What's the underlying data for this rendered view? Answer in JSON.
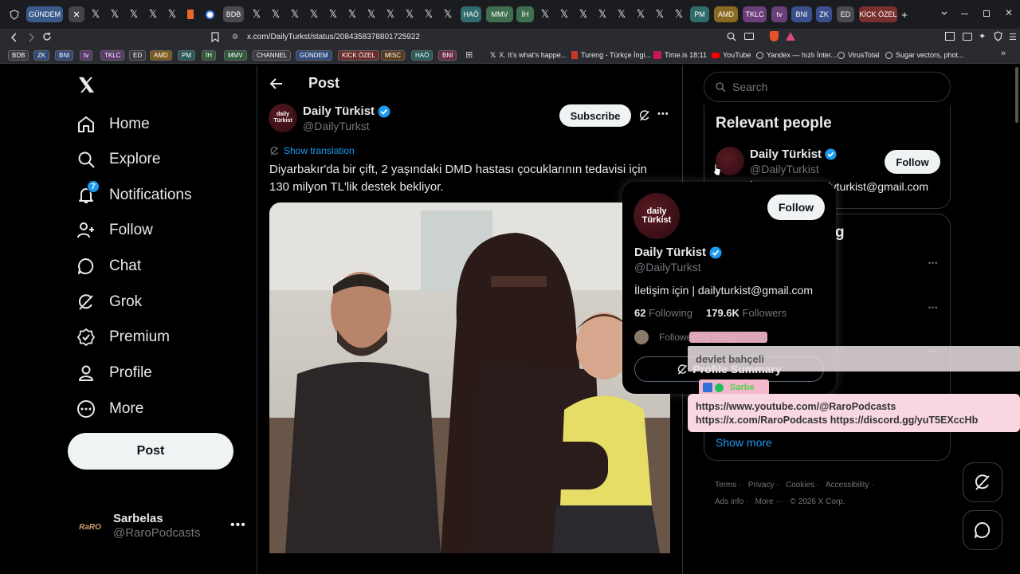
{
  "browser": {
    "tabs": [
      {
        "label": "GÜNDEM",
        "color": "#3a5a8c"
      },
      {
        "label": "BDB",
        "color": "#4a4a52"
      },
      {
        "label": "HAÖ",
        "color": "#2f6c6c"
      },
      {
        "label": "MMV",
        "color": "#3f6f4f"
      },
      {
        "label": "İH",
        "color": "#3f6f4f"
      },
      {
        "label": "PM",
        "color": "#2f6c6c"
      },
      {
        "label": "AMD",
        "color": "#8a6a20"
      },
      {
        "label": "TKLC",
        "color": "#6a3f7a"
      },
      {
        "label": "tv",
        "color": "#6a3f7a"
      },
      {
        "label": "BNI",
        "color": "#3a4f8c"
      },
      {
        "label": "ZK",
        "color": "#3a4f8c"
      },
      {
        "label": "ED",
        "color": "#4a4a52"
      },
      {
        "label": "KİCK ÖZEL",
        "color": "#7a2f2f"
      }
    ],
    "x_tab_glyph": "𝕏",
    "new_tab": "+",
    "url": "x.com/DailyTurkst/status/2084358378801725922",
    "bookmarks_tags": [
      "BDB",
      "ZK",
      "BNI",
      "tv",
      "TKLC",
      "ED",
      "AMD",
      "PM",
      "İH",
      "MMV",
      "CHANNEL",
      "GÜNDEM",
      "KİCK ÖZEL",
      "MISC",
      "HAÖ",
      "BNİ"
    ],
    "bookmark_links": [
      "X. It's what's happe...",
      "Tureng - Türkçe İngi...",
      "Time.is 18:11",
      "YouTube",
      "Yandex — hızlı İnter...",
      "VirusTotal",
      "Sugar vectors, phot..."
    ]
  },
  "sidebar": {
    "items": [
      {
        "label": "Home",
        "icon": "home-icon"
      },
      {
        "label": "Explore",
        "icon": "search-icon"
      },
      {
        "label": "Notifications",
        "icon": "bell-icon",
        "badge": "7"
      },
      {
        "label": "Follow",
        "icon": "add-user-icon"
      },
      {
        "label": "Chat",
        "icon": "chat-icon"
      },
      {
        "label": "Grok",
        "icon": "grok-icon"
      },
      {
        "label": "Premium",
        "icon": "premium-icon"
      },
      {
        "label": "Profile",
        "icon": "profile-icon"
      },
      {
        "label": "More",
        "icon": "more-circle-icon"
      }
    ],
    "post_button": "Post",
    "account": {
      "name": "Sarbelas",
      "handle": "@RaroPodcasts",
      "avatar_text": "RaRO"
    }
  },
  "main": {
    "header_title": "Post",
    "author": {
      "name": "Daily Türkist",
      "handle": "@DailyTurkst",
      "avatar_text": "daily\nTürkist"
    },
    "subscribe": "Subscribe",
    "show_translation": "Show translation",
    "text_line1": "Diyarbakır'da bir çift, 2 yaşındaki DMD hastası çocuklarının tedavisi için",
    "text_line2": "130 milyon TL'lik destek bekliyor."
  },
  "right": {
    "search_placeholder": "Search",
    "relevant_title": "Relevant people",
    "relevant": {
      "name": "Daily Türkist",
      "handle": "@DailyTurkist",
      "bio": "İletişim için | dailyturkist@gmail.com",
      "follow": "Follow"
    },
    "trending_title_partial": "g",
    "show_more": "Show more",
    "footer": [
      "Terms",
      "Privacy",
      "Cookies",
      "Accessibility",
      "Ads info",
      "More ···",
      "© 2026 X Corp."
    ]
  },
  "hovercard": {
    "name": "Daily Türkist",
    "handle": "@DailyTurkst",
    "bio": "İletişim için | dailyturkist@gmail.com",
    "following_count": "62",
    "following_label": "Following",
    "followers_count": "179.6K",
    "followers_label": "Followers",
    "followed_by": "Followed by Umay",
    "follow": "Follow",
    "profile_summary": "Profile Summary"
  },
  "overlay": {
    "name": "devlet bahçeli",
    "tag": "Sarbe",
    "line1": "https://www.youtube.com/@RaroPodcasts",
    "line2": "https://x.com/RaroPodcasts https://discord.gg/yuT5EXccHb"
  },
  "colors": {
    "accent": "#1d9bf0",
    "badge": "#1d9bf0",
    "pink": "#f8d7e3"
  }
}
